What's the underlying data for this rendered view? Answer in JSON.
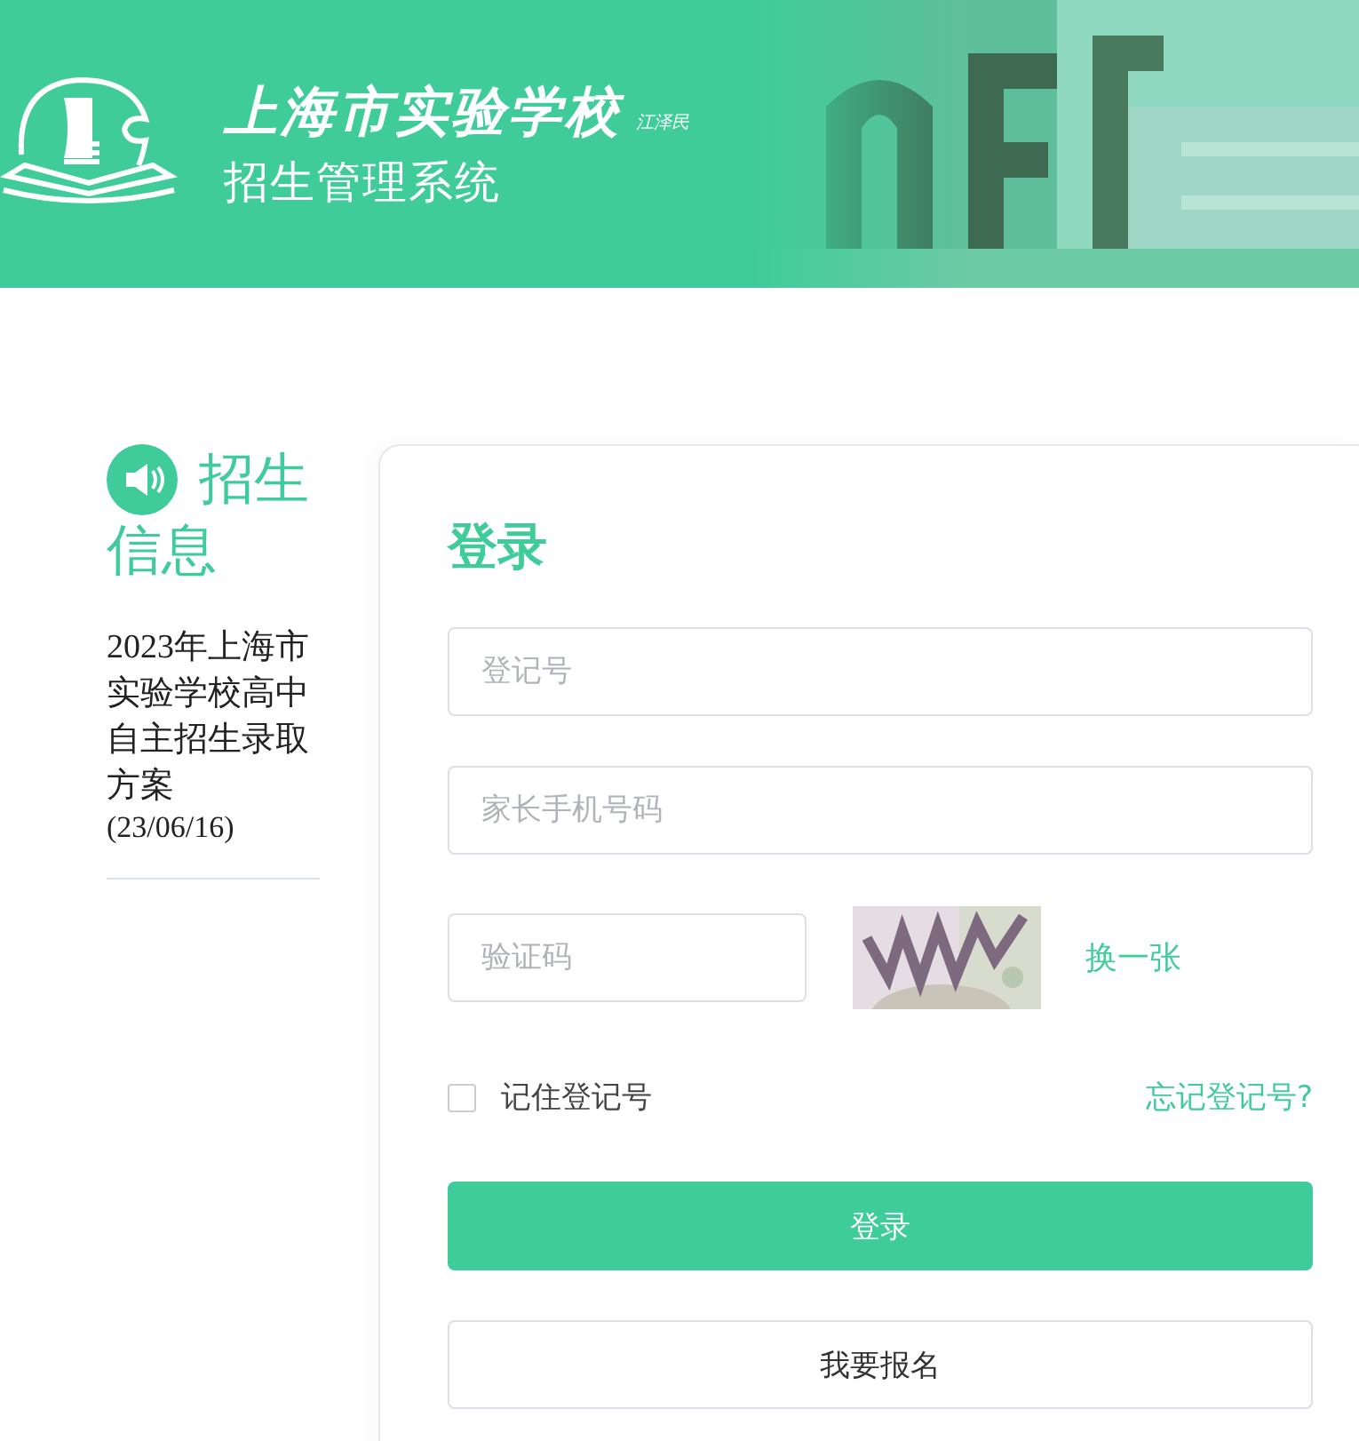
{
  "header": {
    "school_name": "上海市实验学校",
    "signature": "江泽民",
    "system_title": "招生管理系统"
  },
  "news": {
    "title_lines": [
      "招生",
      "信息"
    ],
    "items": [
      {
        "text": "2023年上海市实验学校高中自主招生录取方案",
        "date": "(23/06/16)"
      }
    ]
  },
  "login": {
    "title": "登录",
    "fields": [
      {
        "placeholder": "登记号"
      },
      {
        "placeholder": "家长手机号码"
      }
    ],
    "captcha": {
      "placeholder": "验证码",
      "refresh": "换一张"
    },
    "remember": {
      "label": "记住登记号",
      "checked": false
    },
    "forgot": "忘记登记号?",
    "submit": "登录",
    "register": "我要报名"
  }
}
